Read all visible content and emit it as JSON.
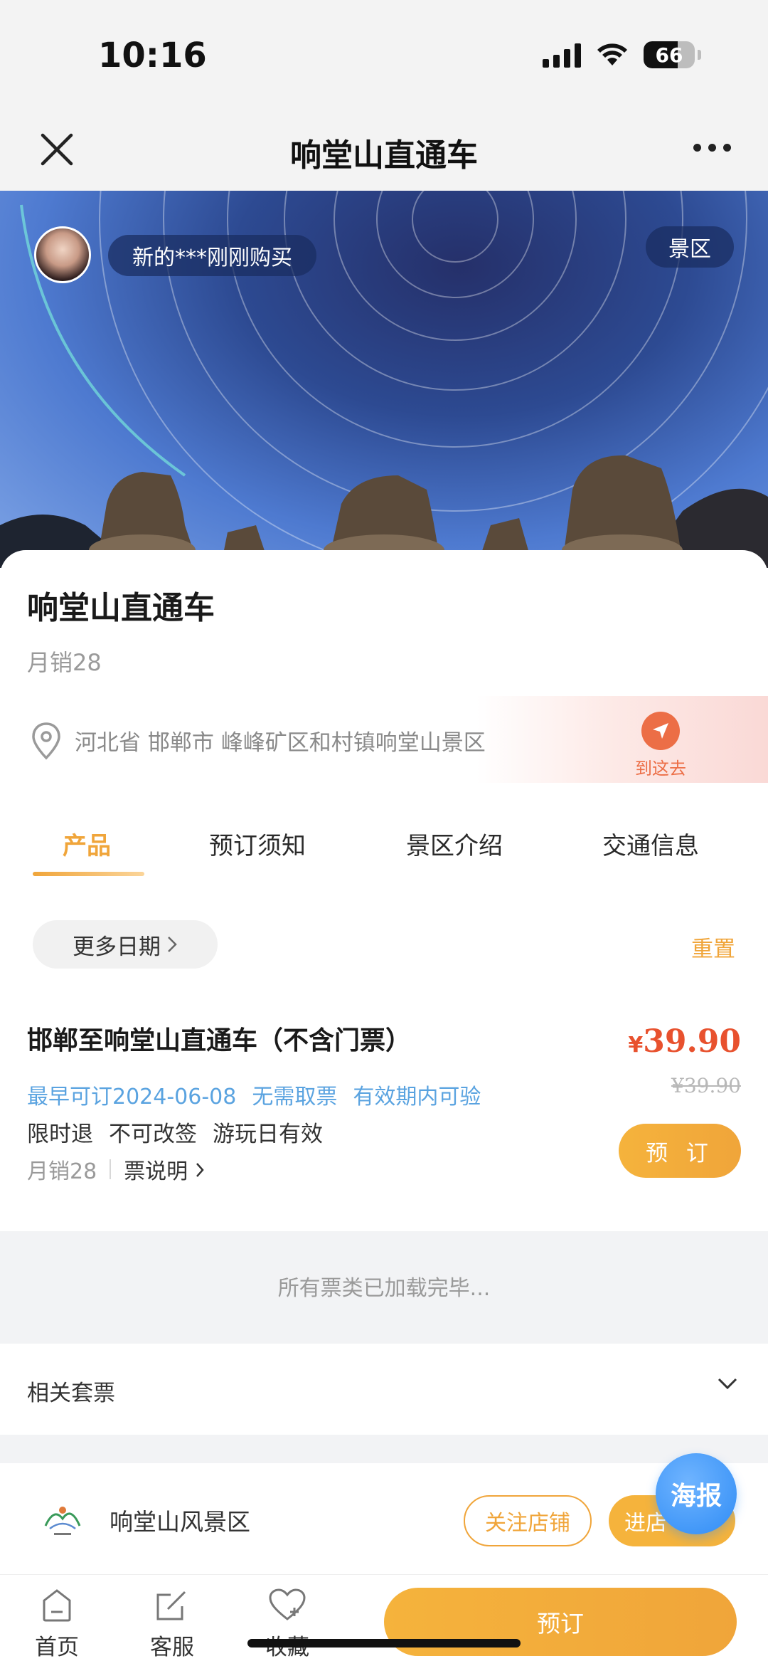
{
  "status_bar": {
    "time": "10:16",
    "battery": "66",
    "battery_level": 0.66
  },
  "navbar": {
    "title": "响堂山直通车"
  },
  "hero": {
    "recent_buyer": "新的***刚刚购买",
    "badge": "景区"
  },
  "product": {
    "title": "响堂山直通车",
    "monthly_sales": "月销28",
    "address": "河北省 邯郸市 峰峰矿区和村镇响堂山景区",
    "goto_label": "到这去"
  },
  "tabs": [
    {
      "label": "产品",
      "active": true
    },
    {
      "label": "预订须知",
      "active": false
    },
    {
      "label": "景区介绍",
      "active": false
    },
    {
      "label": "交通信息",
      "active": false
    }
  ],
  "filter": {
    "more_dates": "更多日期",
    "reset": "重置"
  },
  "ticket": {
    "title": "邯郸至响堂山直通车（不含门票）",
    "tags": [
      "最早可订2024-06-08",
      "无需取票",
      "有效期内可验"
    ],
    "rules": [
      "限时退",
      "不可改签",
      "游玩日有效"
    ],
    "monthly_sales": "月销28",
    "description_link": "票说明",
    "currency": "¥",
    "price": "39.90",
    "original_price": "¥39.90",
    "book_label": "预 订"
  },
  "loaded_text": "所有票类已加载完毕...",
  "related": {
    "label": "相关套票"
  },
  "shop": {
    "name": "响堂山风景区",
    "follow": "关注店铺",
    "enter": "进店",
    "poster": "海报"
  },
  "bottom_bar": {
    "home": "首页",
    "service": "客服",
    "favorite": "收藏",
    "book": "预订"
  },
  "colors": {
    "accent": "#f0a53a",
    "price": "#e8512e",
    "tag_blue": "#5aa3e0",
    "poster_blue": "#2f8cf5"
  },
  "icons": [
    "close-icon",
    "more-icon",
    "location-pin-icon",
    "navigate-icon",
    "chevron-right-icon",
    "chevron-down-icon",
    "home-icon",
    "edit-icon",
    "heart-plus-icon",
    "signal-icon",
    "wifi-icon",
    "battery-icon"
  ]
}
